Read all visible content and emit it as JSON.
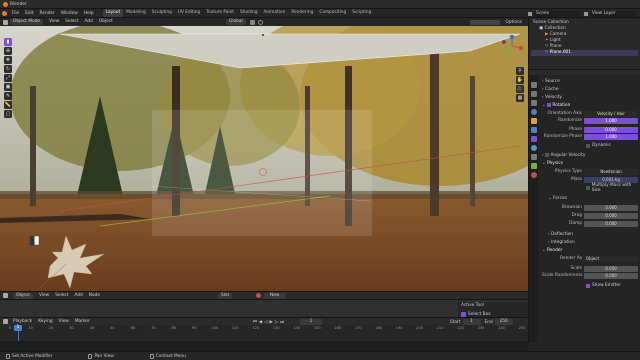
{
  "topbar": {
    "app_title": "Blender",
    "menus": [
      "File",
      "Edit",
      "Render",
      "Window",
      "Help"
    ],
    "workspaces": [
      "Layout",
      "Modeling",
      "Sculpting",
      "UV Editing",
      "Texture Paint",
      "Shading",
      "Animation",
      "Rendering",
      "Compositing",
      "Scripting"
    ],
    "active_workspace": "Layout",
    "scene": "Scene",
    "view_layer": "View Layer"
  },
  "viewport": {
    "mode": "Object Mode",
    "menus": [
      "View",
      "Select",
      "Add",
      "Object"
    ],
    "transform": "Global",
    "options": "Options"
  },
  "outliner": {
    "title": "Scene Collection",
    "items": [
      "Collection",
      "Camera",
      "Light",
      "Plane",
      "Plane.001"
    ]
  },
  "properties": {
    "sections": {
      "source": "Source",
      "cache": "Cache",
      "velocity": "Velocity",
      "rotation": "Rotation",
      "angular_velocity": "Angular Velocity",
      "physics": "Physics",
      "forces": "Forces",
      "deflection": "Deflection",
      "integration": "Integration",
      "render": "Render"
    },
    "orientation_axis_label": "Orientation Axis",
    "orientation_axis_value": "Velocity / Hair",
    "randomize_label": "Randomize",
    "randomize_value": "1.000",
    "phase_label": "Phase",
    "phase_value": "0.000",
    "randomize_phase_label": "Randomize Phase",
    "randomize_phase_value": "1.000",
    "dynamic_label": "Dynamic",
    "physics_type_label": "Physics Type",
    "physics_type_value": "Newtonian",
    "mass_label": "Mass",
    "mass_value": "0.001 kg",
    "multiply_mass_label": "Multiply Mass with Size",
    "brownian_label": "Brownian",
    "brownian_value": "0.000",
    "drag_label": "Drag",
    "drag_value": "0.000",
    "damp_label": "Damp",
    "damp_value": "0.000",
    "render_as_label": "Render As",
    "render_as_value": "Object",
    "scale_label": "Scale",
    "scale_value": "0.050",
    "scale_randomness_label": "Scale Randomness",
    "scale_randomness_value": "0.000",
    "show_emitter_label": "Show Emitter"
  },
  "node_editor": {
    "type": "Object",
    "menus": [
      "View",
      "Select",
      "Add",
      "Node"
    ],
    "slot": "Slot",
    "new_label": "New"
  },
  "active_tool": {
    "title": "Active Tool",
    "tool": "Select Box"
  },
  "timeline": {
    "menus": [
      "Playback",
      "Keying",
      "View",
      "Marker"
    ],
    "ticks": [
      "0",
      "10",
      "20",
      "30",
      "40",
      "50",
      "60",
      "70",
      "80",
      "90",
      "100",
      "110",
      "120",
      "130",
      "140",
      "150",
      "160",
      "170",
      "180",
      "190",
      "200",
      "210",
      "220",
      "230",
      "240",
      "250"
    ],
    "current_frame": "1",
    "start_label": "Start",
    "start_value": "1",
    "end_label": "End",
    "end_value": "250"
  },
  "status": {
    "items": [
      "Set Active Modifier",
      "Pan View",
      "Context Menu"
    ]
  },
  "colors": {
    "accent": "#7c4fd8",
    "header": "#2b2b2b",
    "panel": "#242424",
    "timeline_playhead": "#4a7fd8"
  }
}
